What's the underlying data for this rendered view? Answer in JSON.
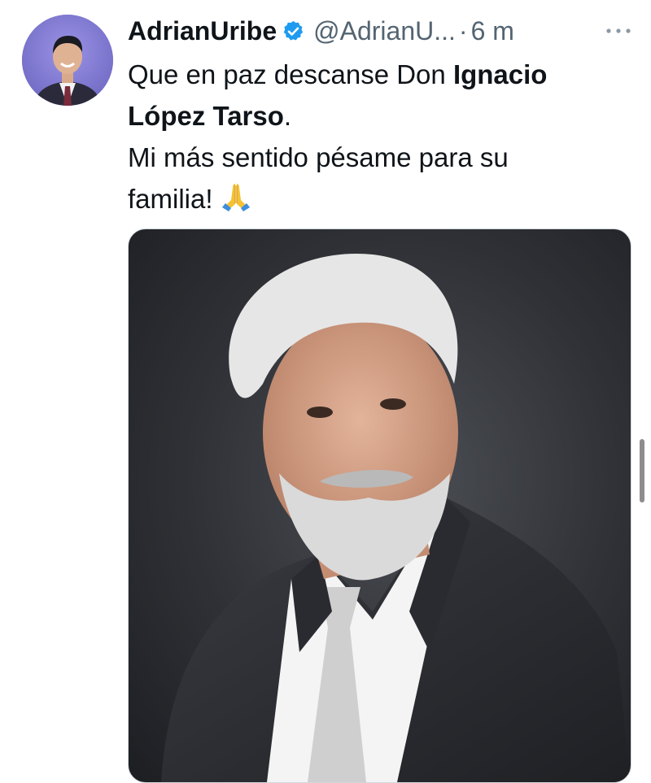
{
  "tweet": {
    "display_name": "AdrianUribe",
    "handle": "@AdrianU...",
    "separator": "·",
    "time": "6 m",
    "more_label": "···",
    "text": {
      "line1_prefix": "Que en paz descanse Don ",
      "line1_bold": "Ignacio",
      "line2_bold": "López Tarso",
      "line2_suffix": ".",
      "line3": "Mi más sentido pésame para su",
      "line4": "familia!"
    },
    "icons": {
      "verified": "verified-badge-icon",
      "more": "more-icon",
      "emoji": "folded-hands-icon"
    }
  },
  "colors": {
    "accent": "#1d9bf0",
    "text_primary": "#0f1419",
    "text_secondary": "#536471",
    "avatar_bg": "#7f79cf"
  }
}
